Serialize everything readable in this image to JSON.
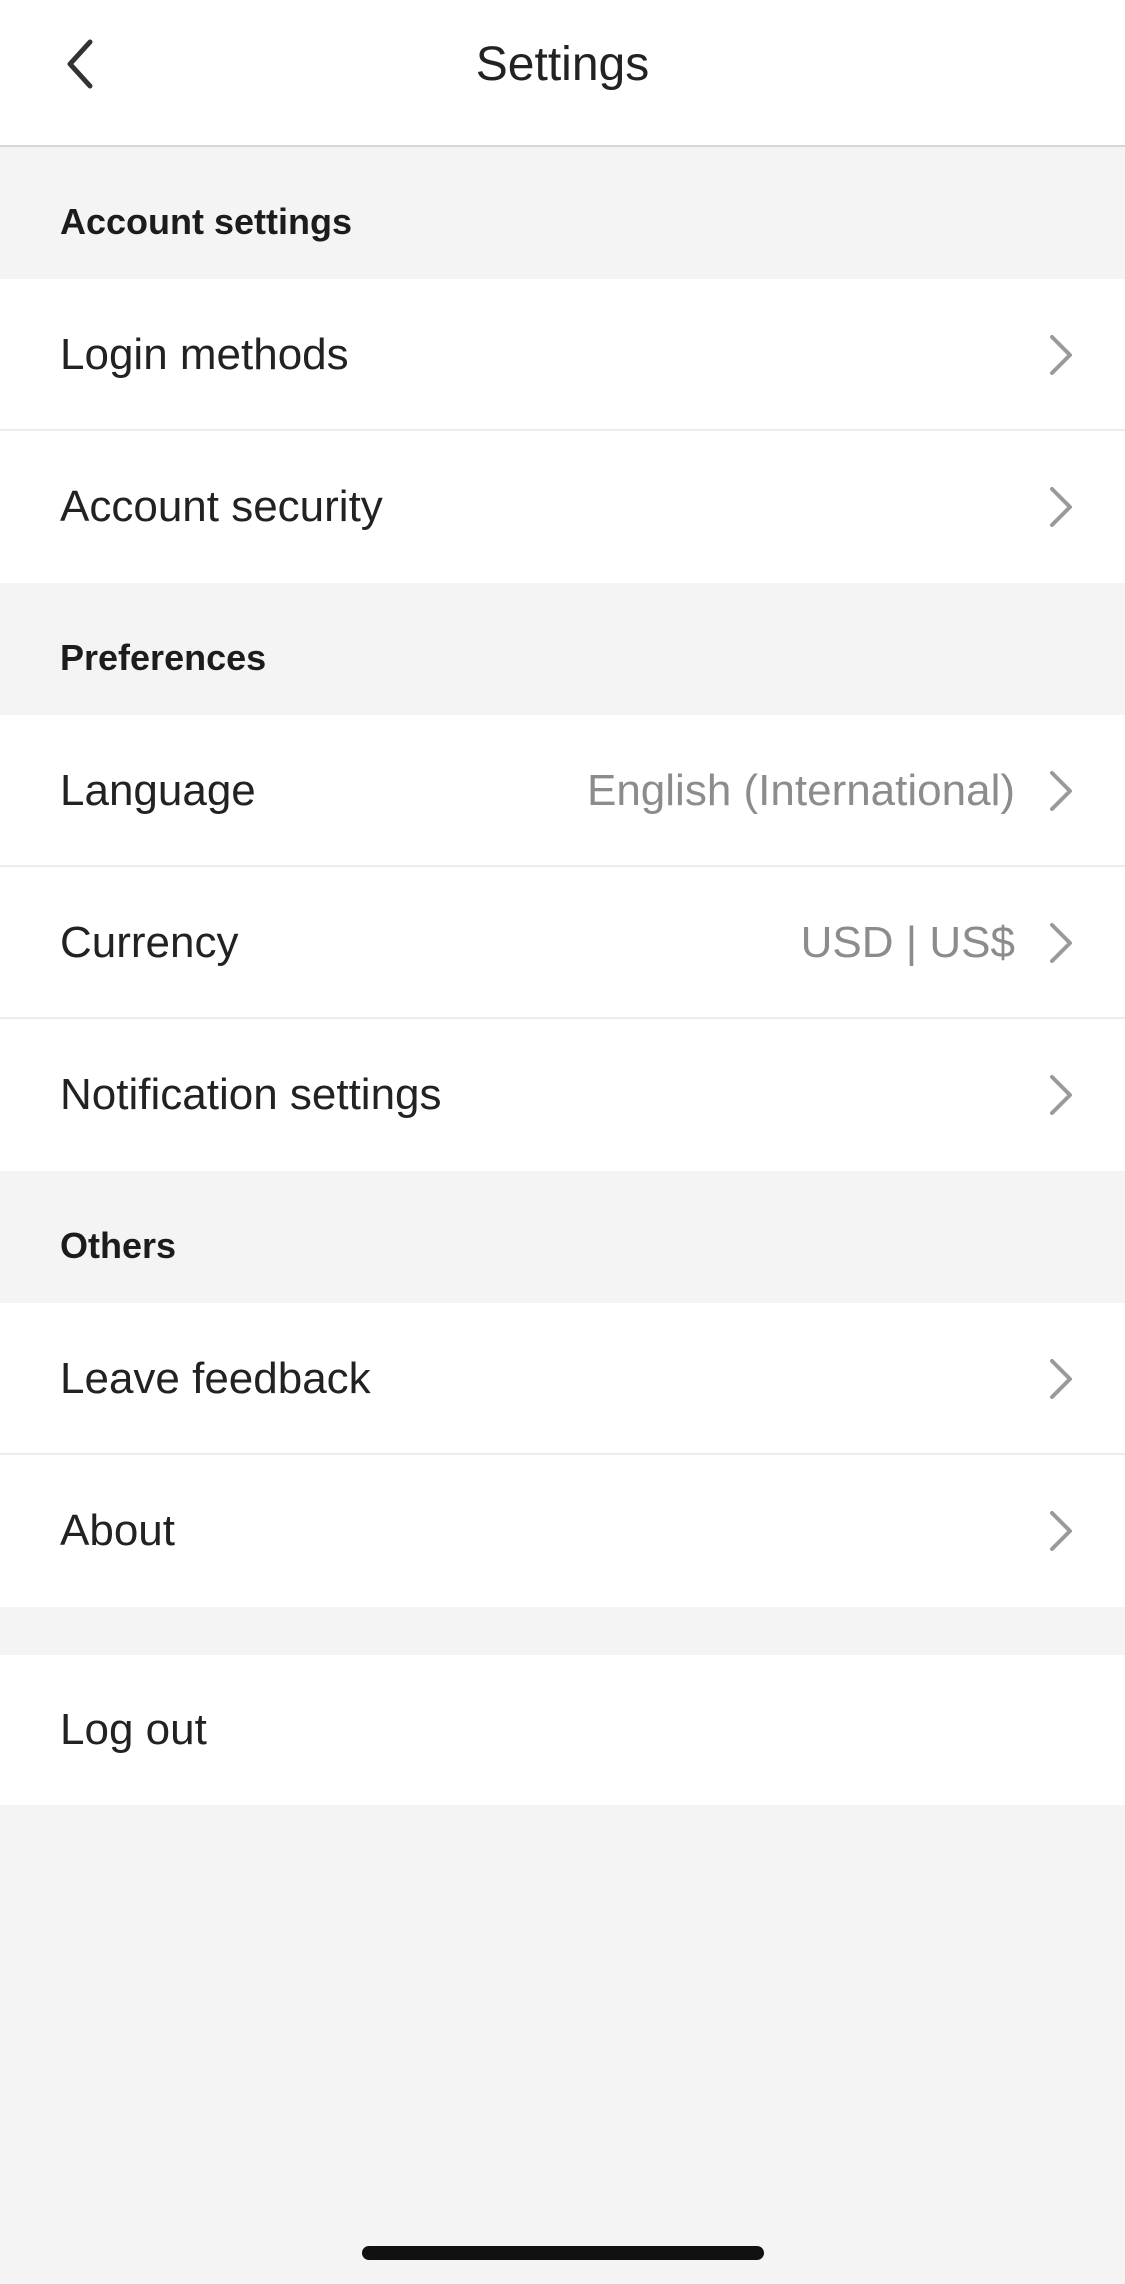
{
  "header": {
    "title": "Settings",
    "back_icon": "chevron-left-icon"
  },
  "sections": {
    "account": {
      "title": "Account settings",
      "items": [
        {
          "label": "Login methods"
        },
        {
          "label": "Account security"
        }
      ]
    },
    "preferences": {
      "title": "Preferences",
      "items": [
        {
          "label": "Language",
          "value": "English (International)"
        },
        {
          "label": "Currency",
          "value": "USD | US$"
        },
        {
          "label": "Notification settings"
        }
      ]
    },
    "others": {
      "title": "Others",
      "items": [
        {
          "label": "Leave feedback"
        },
        {
          "label": "About"
        }
      ]
    }
  },
  "logout": {
    "label": "Log out"
  },
  "colors": {
    "background": "#f4f4f4",
    "card": "#ffffff",
    "text": "#222222",
    "secondary_text": "#8c8c8c",
    "chevron": "#9a9a9a"
  }
}
